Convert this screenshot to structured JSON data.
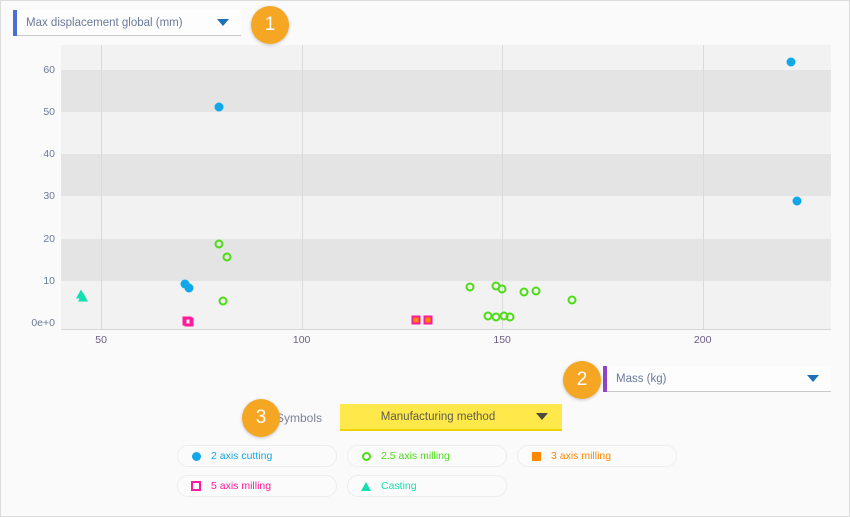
{
  "yaxis_selector": {
    "value": "Max displacement global (mm)",
    "caret_icon": "chevron-down-icon",
    "accent_color": "#4a6fd4"
  },
  "xaxis_selector": {
    "value": "Mass (kg)",
    "caret_icon": "chevron-down-icon",
    "accent_color": "#8e44c9"
  },
  "symbols_control": {
    "label": "Symbols",
    "value": "Manufacturing method",
    "caret_icon": "chevron-down-icon",
    "highlight_color": "#ffe94a"
  },
  "badges": [
    {
      "number": "1"
    },
    {
      "number": "2"
    },
    {
      "number": "3"
    }
  ],
  "legend": {
    "items": [
      {
        "label": "2 axis cutting",
        "color": "#12a7e8",
        "marker": "circle-filled"
      },
      {
        "label": "2.5 axis milling",
        "color": "#4ddb16",
        "marker": "circle-open"
      },
      {
        "label": "3 axis milling",
        "color": "#ff8800",
        "marker": "square-filled"
      },
      {
        "label": "5 axis milling",
        "color": "#ff1a9b",
        "marker": "square-open"
      },
      {
        "label": "Casting",
        "color": "#14dfae",
        "marker": "triangle"
      }
    ]
  },
  "chart_data": {
    "type": "scatter",
    "title": "",
    "xlabel": "Mass (kg)",
    "ylabel": "Max displacement global (mm)",
    "xlim": [
      40,
      232
    ],
    "ylim": [
      -1.5,
      66
    ],
    "xticks": [
      50,
      100,
      150,
      200
    ],
    "yticks": [
      "0e+0",
      "10",
      "20",
      "30",
      "40",
      "50",
      "60"
    ],
    "ytick_values": [
      0,
      10,
      20,
      30,
      40,
      50,
      60
    ],
    "grid": "horizontal-bands",
    "legend_position": "bottom",
    "series": [
      {
        "name": "2 axis cutting",
        "color": "#12a7e8",
        "marker": "circle-filled",
        "points": [
          {
            "x": 79.5,
            "y": 51.3
          },
          {
            "x": 222.0,
            "y": 62.0
          },
          {
            "x": 223.5,
            "y": 29.0
          },
          {
            "x": 71.0,
            "y": 9.3
          },
          {
            "x": 71.8,
            "y": 8.3
          }
        ]
      },
      {
        "name": "2.5 axis milling",
        "color": "#4ddb16",
        "marker": "circle-open",
        "points": [
          {
            "x": 79.5,
            "y": 18.8
          },
          {
            "x": 81.5,
            "y": 15.6
          },
          {
            "x": 80.5,
            "y": 5.2
          },
          {
            "x": 142.0,
            "y": 8.6
          },
          {
            "x": 148.5,
            "y": 8.8
          },
          {
            "x": 150.0,
            "y": 8.0
          },
          {
            "x": 155.5,
            "y": 7.2
          },
          {
            "x": 158.5,
            "y": 7.6
          },
          {
            "x": 167.5,
            "y": 5.3
          },
          {
            "x": 146.5,
            "y": 1.6
          },
          {
            "x": 148.5,
            "y": 1.4
          },
          {
            "x": 150.5,
            "y": 1.5
          },
          {
            "x": 152.0,
            "y": 1.3
          }
        ]
      },
      {
        "name": "3 axis milling",
        "color": "#ff8800",
        "marker": "square-filled",
        "points": [
          {
            "x": 128.5,
            "y": 0.6
          },
          {
            "x": 131.5,
            "y": 0.6
          }
        ]
      },
      {
        "name": "5 axis milling",
        "color": "#ff1a9b",
        "marker": "square-open",
        "points": [
          {
            "x": 128.5,
            "y": 0.6
          },
          {
            "x": 131.5,
            "y": 0.6
          },
          {
            "x": 71.5,
            "y": 0.5
          },
          {
            "x": 72.0,
            "y": 0.2
          }
        ]
      },
      {
        "name": "Casting",
        "color": "#14dfae",
        "marker": "triangle",
        "points": [
          {
            "x": 45.0,
            "y": 6.8
          },
          {
            "x": 45.6,
            "y": 6.2
          }
        ]
      }
    ]
  }
}
